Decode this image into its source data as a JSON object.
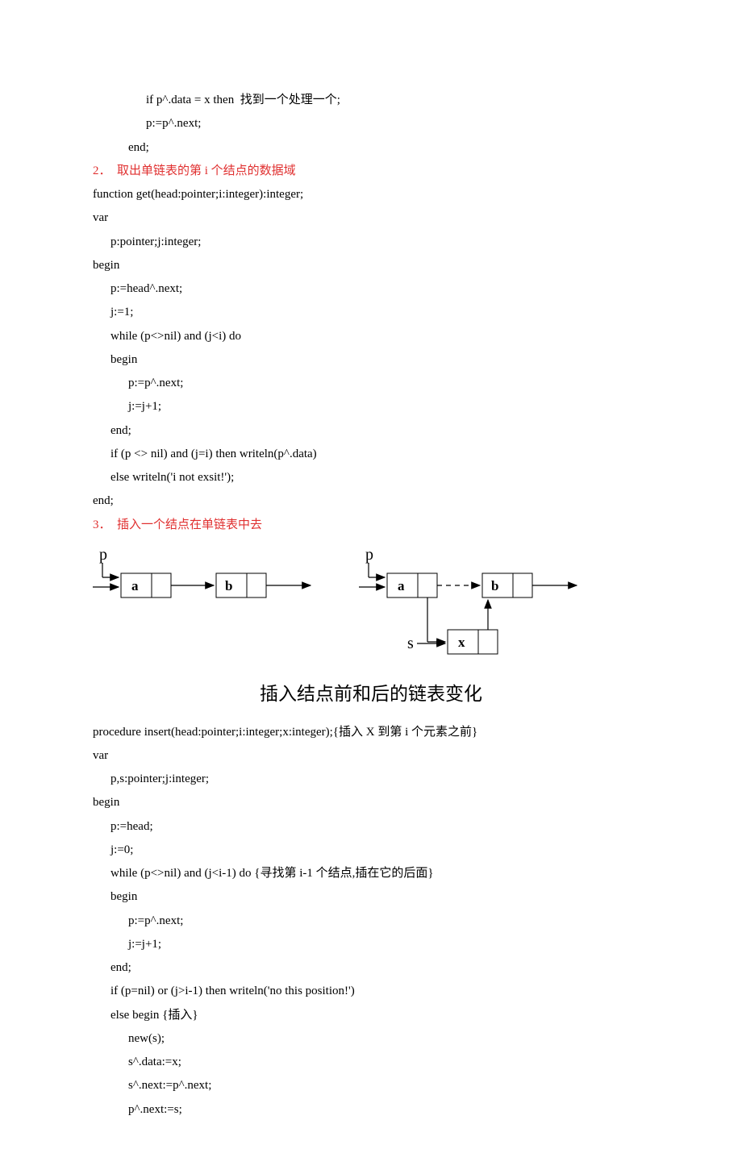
{
  "block1": {
    "l1": "if p^.data = x then  找到一个处理一个;",
    "l2": "p:=p^.next;",
    "l3": "end;"
  },
  "heading2": "2．  取出单链表的第 i 个结点的数据域",
  "block2": {
    "l1": "function get(head:pointer;i:integer):integer;",
    "l2": "var",
    "l3": "p:pointer;j:integer;",
    "l4": "begin",
    "l5": "p:=head^.next;",
    "l6": "j:=1;",
    "l7": "while (p<>nil) and (j<i) do",
    "l8": "begin",
    "l9": "p:=p^.next;",
    "l10": "j:=j+1;",
    "l11": "end;",
    "l12": "if (p <> nil) and (j=i) then writeln(p^.data)",
    "l13": "else writeln('i not exsit!');",
    "l14": "end;"
  },
  "heading3": "3．  插入一个结点在单链表中去",
  "diagram": {
    "p1": "p",
    "p2": "p",
    "s": "s",
    "a1": "a",
    "b1": "b",
    "a2": "a",
    "b2": "b",
    "x": "x"
  },
  "caption": "插入结点前和后的链表变化",
  "block3": {
    "l1": "procedure insert(head:pointer;i:integer;x:integer);{插入 X 到第 i 个元素之前}",
    "l2": "var",
    "l3": "p,s:pointer;j:integer;",
    "l4": "begin",
    "l5": "p:=head;",
    "l6": "j:=0;",
    "l7": "while (p<>nil) and (j<i-1) do {寻找第 i-1 个结点,插在它的后面}",
    "l8": "begin",
    "l9": "p:=p^.next;",
    "l10": "j:=j+1;",
    "l11": "end;",
    "l12": "if (p=nil) or (j>i-1) then writeln('no this position!')",
    "l13": "else begin {插入}",
    "l14": "new(s);",
    "l15": "s^.data:=x;",
    "l16": "s^.next:=p^.next;",
    "l17": "p^.next:=s;"
  }
}
